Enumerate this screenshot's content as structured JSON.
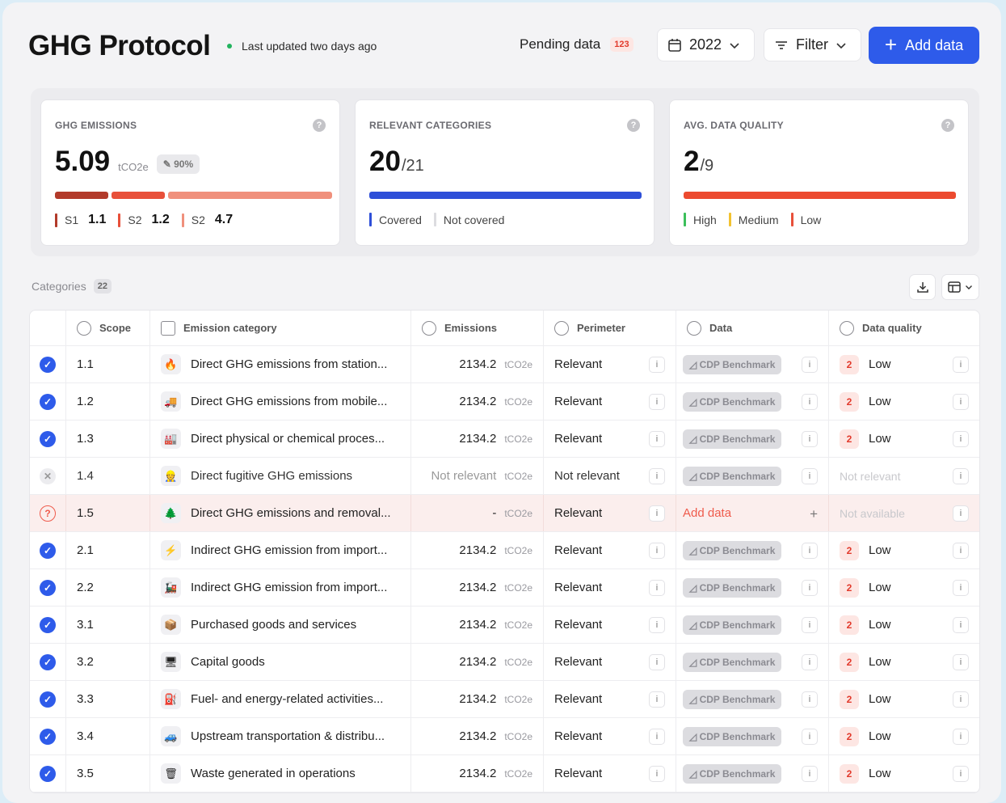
{
  "header": {
    "title": "GHG Protocol",
    "updated": "Last updated two days ago",
    "pending_label": "Pending data",
    "pending_count": "123",
    "year": "2022",
    "filter": "Filter",
    "add": "Add data"
  },
  "cards": {
    "emissions": {
      "title": "GHG EMISSIONS",
      "value": "5.09",
      "unit": "tCO2e",
      "percent": "90%",
      "legend": [
        {
          "label": "S1",
          "value": "1.1",
          "color": "#b23a2a"
        },
        {
          "label": "S2",
          "value": "1.2",
          "color": "#e8503a"
        },
        {
          "label": "S2",
          "value": "4.7",
          "color": "#f0907c"
        }
      ]
    },
    "categories": {
      "title": "RELEVANT CATEGORIES",
      "value": "20",
      "total": "/21",
      "legend": [
        {
          "label": "Covered",
          "color": "#2e4fd8"
        },
        {
          "label": "Not covered",
          "color": "#dcdce0"
        }
      ]
    },
    "quality": {
      "title": "AVG. DATA QUALITY",
      "value": "2",
      "total": "/9",
      "legend": [
        {
          "label": "High",
          "color": "#3bbf5a"
        },
        {
          "label": "Medium",
          "color": "#f2c230"
        },
        {
          "label": "Low",
          "color": "#e8503a"
        }
      ]
    }
  },
  "categories_label": "Categories",
  "categories_count": "22",
  "table": {
    "headers": {
      "scope": "Scope",
      "category": "Emission category",
      "emissions": "Emissions",
      "perimeter": "Perimeter",
      "data": "Data",
      "quality": "Data quality"
    },
    "rows": [
      {
        "scope": "1.1",
        "icon": "🔥",
        "name": "Direct GHG emissions from station...",
        "emissions": "2134.2",
        "unit": "tCO2e",
        "perimeter": "Relevant",
        "data": "CDP Benchmark",
        "level": "2",
        "quality": "Low",
        "status": "check"
      },
      {
        "scope": "1.2",
        "icon": "🚚",
        "name": "Direct GHG emissions from mobile...",
        "emissions": "2134.2",
        "unit": "tCO2e",
        "perimeter": "Relevant",
        "data": "CDP Benchmark",
        "level": "2",
        "quality": "Low",
        "status": "check"
      },
      {
        "scope": "1.3",
        "icon": "🏭",
        "name": "Direct physical or chemical proces...",
        "emissions": "2134.2",
        "unit": "tCO2e",
        "perimeter": "Relevant",
        "data": "CDP Benchmark",
        "level": "2",
        "quality": "Low",
        "status": "check"
      },
      {
        "scope": "1.4",
        "icon": "👷",
        "name": "Direct fugitive GHG emissions",
        "emissions": "Not relevant",
        "unit": "tCO2e",
        "perimeter": "Not relevant",
        "data": "CDP Benchmark",
        "level": "",
        "quality": "Not relevant",
        "status": "x"
      },
      {
        "scope": "1.5",
        "icon": "🌲",
        "name": "Direct GHG emissions and removal...",
        "emissions": "-",
        "unit": "tCO2e",
        "perimeter": "Relevant",
        "data": "Add data",
        "level": "",
        "quality": "Not available",
        "status": "q"
      },
      {
        "scope": "2.1",
        "icon": "⚡",
        "name": "Indirect GHG emission from import...",
        "emissions": "2134.2",
        "unit": "tCO2e",
        "perimeter": "Relevant",
        "data": "CDP Benchmark",
        "level": "2",
        "quality": "Low",
        "status": "check"
      },
      {
        "scope": "2.2",
        "icon": "🚂",
        "name": "Indirect GHG emission from import...",
        "emissions": "2134.2",
        "unit": "tCO2e",
        "perimeter": "Relevant",
        "data": "CDP Benchmark",
        "level": "2",
        "quality": "Low",
        "status": "check"
      },
      {
        "scope": "3.1",
        "icon": "📦",
        "name": "Purchased goods and services",
        "emissions": "2134.2",
        "unit": "tCO2e",
        "perimeter": "Relevant",
        "data": "CDP Benchmark",
        "level": "2",
        "quality": "Low",
        "status": "check"
      },
      {
        "scope": "3.2",
        "icon": "🖥",
        "name": "Capital goods",
        "emissions": "2134.2",
        "unit": "tCO2e",
        "perimeter": "Relevant",
        "data": "CDP Benchmark",
        "level": "2",
        "quality": "Low",
        "status": "check"
      },
      {
        "scope": "3.3",
        "icon": "⛽",
        "name": "Fuel- and energy-related activities...",
        "emissions": "2134.2",
        "unit": "tCO2e",
        "perimeter": "Relevant",
        "data": "CDP Benchmark",
        "level": "2",
        "quality": "Low",
        "status": "check"
      },
      {
        "scope": "3.4",
        "icon": "🚙",
        "name": "Upstream transportation & distribu...",
        "emissions": "2134.2",
        "unit": "tCO2e",
        "perimeter": "Relevant",
        "data": "CDP Benchmark",
        "level": "2",
        "quality": "Low",
        "status": "check"
      },
      {
        "scope": "3.5",
        "icon": "🗑",
        "name": "Waste generated in operations",
        "emissions": "2134.2",
        "unit": "tCO2e",
        "perimeter": "Relevant",
        "data": "CDP Benchmark",
        "level": "2",
        "quality": "Low",
        "status": "check"
      }
    ]
  }
}
